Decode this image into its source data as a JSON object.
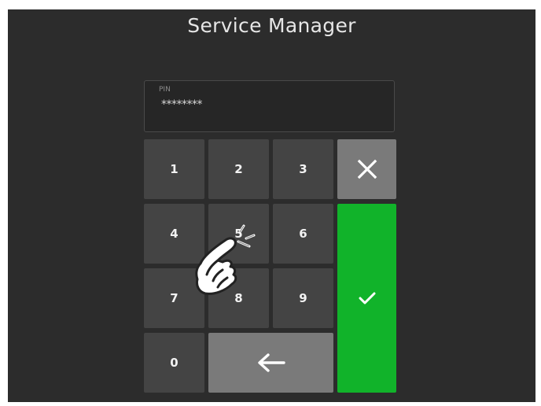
{
  "header": {
    "title": "Service Manager"
  },
  "pin": {
    "label": "PIN",
    "value": "********"
  },
  "keypad": {
    "digits": [
      "1",
      "2",
      "3",
      "4",
      "5",
      "6",
      "7",
      "8",
      "9",
      "0"
    ],
    "clear_icon": "close-icon",
    "backspace_icon": "arrow-left-icon",
    "confirm_icon": "checkmark-icon"
  },
  "overlay": {
    "gesture_icon": "hand-tap-icon"
  },
  "colors": {
    "screen_bg": "#2c2c2c",
    "key_bg": "#444444",
    "secondary_key_bg": "#7a7a7a",
    "confirm_bg": "#11b32a"
  }
}
